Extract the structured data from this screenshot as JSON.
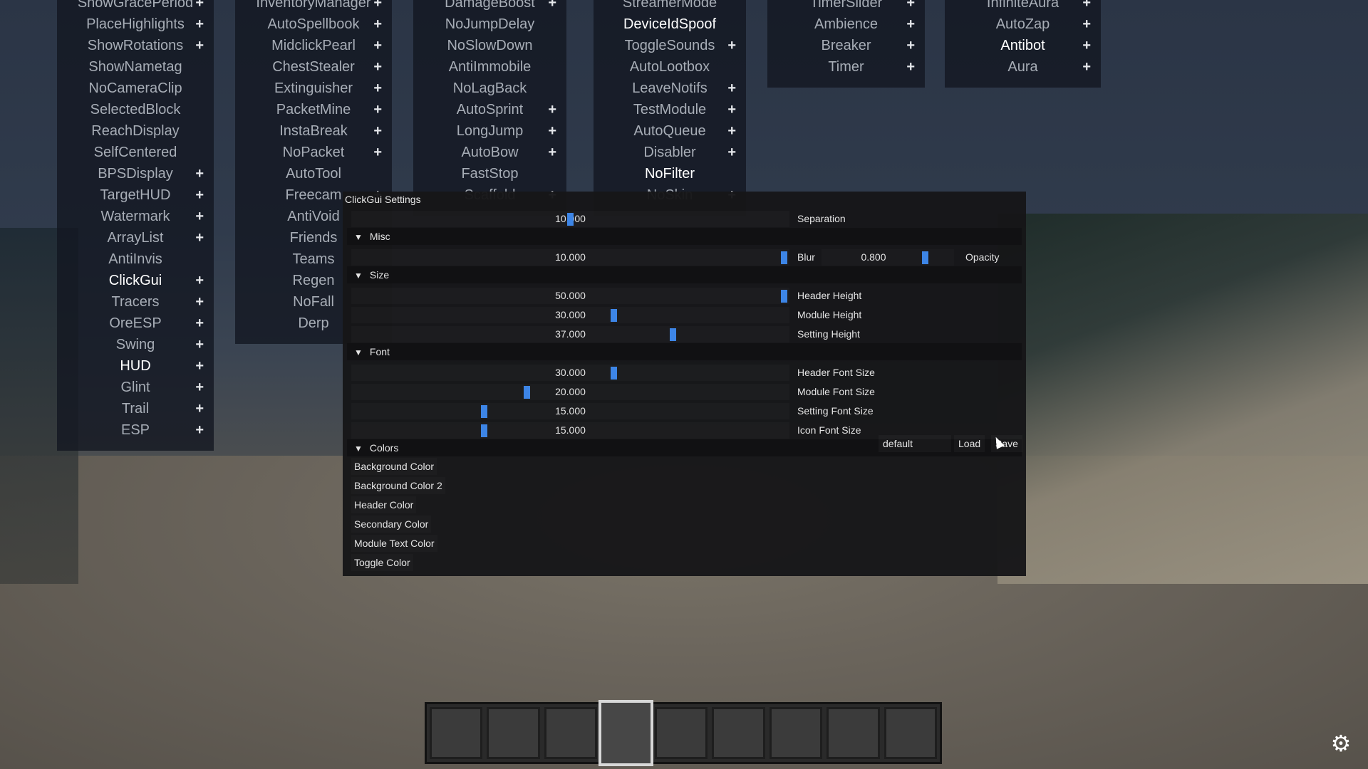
{
  "columns": [
    {
      "items": [
        {
          "name": "ShowGracePeriod",
          "plus": true
        },
        {
          "name": "PlaceHighlights",
          "plus": true
        },
        {
          "name": "ShowRotations",
          "plus": true
        },
        {
          "name": "ShowNametag",
          "plus": false
        },
        {
          "name": "NoCameraClip",
          "plus": false
        },
        {
          "name": "SelectedBlock",
          "plus": false
        },
        {
          "name": "ReachDisplay",
          "plus": false
        },
        {
          "name": "SelfCentered",
          "plus": false
        },
        {
          "name": "BPSDisplay",
          "plus": true
        },
        {
          "name": "TargetHUD",
          "plus": true
        },
        {
          "name": "Watermark",
          "plus": true
        },
        {
          "name": "ArrayList",
          "plus": true
        },
        {
          "name": "AntiInvis",
          "plus": false
        },
        {
          "name": "ClickGui",
          "plus": true,
          "enabled": true
        },
        {
          "name": "Tracers",
          "plus": true
        },
        {
          "name": "OreESP",
          "plus": true
        },
        {
          "name": "Swing",
          "plus": true
        },
        {
          "name": "HUD",
          "plus": true,
          "enabled": true
        },
        {
          "name": "Glint",
          "plus": true
        },
        {
          "name": "Trail",
          "plus": true
        },
        {
          "name": "ESP",
          "plus": true
        }
      ]
    },
    {
      "items": [
        {
          "name": "InventoryManager",
          "plus": true
        },
        {
          "name": "AutoSpellbook",
          "plus": true
        },
        {
          "name": "MidclickPearl",
          "plus": true
        },
        {
          "name": "ChestStealer",
          "plus": true
        },
        {
          "name": "Extinguisher",
          "plus": true
        },
        {
          "name": "PacketMine",
          "plus": true
        },
        {
          "name": "InstaBreak",
          "plus": true
        },
        {
          "name": "NoPacket",
          "plus": true
        },
        {
          "name": "AutoTool",
          "plus": false
        },
        {
          "name": "Freecam",
          "plus": true
        },
        {
          "name": "AntiVoid",
          "plus": false
        },
        {
          "name": "Friends",
          "plus": false
        },
        {
          "name": "Teams",
          "plus": false
        },
        {
          "name": "Regen",
          "plus": false
        },
        {
          "name": "NoFall",
          "plus": false
        },
        {
          "name": "Derp",
          "plus": false
        }
      ]
    },
    {
      "items": [
        {
          "name": "DamageBoost",
          "plus": true
        },
        {
          "name": "NoJumpDelay",
          "plus": false
        },
        {
          "name": "NoSlowDown",
          "plus": false
        },
        {
          "name": "AntiImmobile",
          "plus": false
        },
        {
          "name": "NoLagBack",
          "plus": false
        },
        {
          "name": "AutoSprint",
          "plus": true
        },
        {
          "name": "LongJump",
          "plus": true
        },
        {
          "name": "AutoBow",
          "plus": true
        },
        {
          "name": "FastStop",
          "plus": false
        },
        {
          "name": "Scaffold",
          "plus": true
        }
      ]
    },
    {
      "items": [
        {
          "name": "StreamerMode",
          "plus": false
        },
        {
          "name": "DeviceIdSpoof",
          "plus": false,
          "enabled": true
        },
        {
          "name": "ToggleSounds",
          "plus": true
        },
        {
          "name": "AutoLootbox",
          "plus": false
        },
        {
          "name": "LeaveNotifs",
          "plus": true
        },
        {
          "name": "TestModule",
          "plus": true
        },
        {
          "name": "AutoQueue",
          "plus": true
        },
        {
          "name": "Disabler",
          "plus": true
        },
        {
          "name": "NoFilter",
          "plus": false,
          "enabled": true
        },
        {
          "name": "NoSkin",
          "plus": true
        }
      ]
    },
    {
      "items": [
        {
          "name": "TimerSlider",
          "plus": true
        },
        {
          "name": "Ambience",
          "plus": true
        },
        {
          "name": "Breaker",
          "plus": true
        },
        {
          "name": "Timer",
          "plus": true
        }
      ]
    },
    {
      "items": [
        {
          "name": "InfiniteAura",
          "plus": true
        },
        {
          "name": "AutoZap",
          "plus": true
        },
        {
          "name": "Antibot",
          "plus": true,
          "enabled": true
        },
        {
          "name": "Aura",
          "plus": true
        }
      ]
    }
  ],
  "settings": {
    "title": "ClickGui Settings",
    "separation": {
      "value": "10.000",
      "label": "Separation",
      "fill": 0.5
    },
    "categories": {
      "misc": "Misc",
      "size": "Size",
      "font": "Font",
      "colors": "Colors"
    },
    "blur": {
      "value": "10.000",
      "label": "Blur",
      "fill": 0.995
    },
    "opacity": {
      "value": "0.800",
      "label": "Opacity",
      "fill": 0.8
    },
    "header_height": {
      "value": "50.000",
      "label": "Header Height",
      "fill": 0.995
    },
    "module_height": {
      "value": "30.000",
      "label": "Module Height",
      "fill": 0.6
    },
    "setting_height": {
      "value": "37.000",
      "label": "Setting Height",
      "fill": 0.737
    },
    "header_font_size": {
      "value": "30.000",
      "label": "Header Font Size",
      "fill": 0.6
    },
    "module_font_size": {
      "value": "20.000",
      "label": "Module Font Size",
      "fill": 0.4
    },
    "setting_font_size": {
      "value": "15.000",
      "label": "Setting Font Size",
      "fill": 0.3
    },
    "icon_font_size": {
      "value": "15.000",
      "label": "Icon Font Size",
      "fill": 0.3
    },
    "colors": [
      "Background Color",
      "Background Color 2",
      "Header Color",
      "Secondary Color",
      "Module Text Color",
      "Toggle Color"
    ],
    "config": {
      "name": "default",
      "load": "Load",
      "save": "Save"
    }
  },
  "hotbar": {
    "slots": 9,
    "selected": 4
  },
  "accent_color": "#3d85e6",
  "icons": {
    "settings": "gear-icon",
    "collapse": "triangle-down-icon"
  }
}
